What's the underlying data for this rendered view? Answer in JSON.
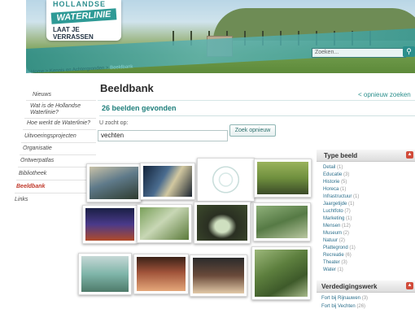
{
  "logo": {
    "line1": "HOLLANDSE",
    "line2": "WATERLINIE",
    "tagline": "LAAT JE VERRASSEN"
  },
  "search": {
    "placeholder": "Zoeken...",
    "button_icon": "search-icon"
  },
  "breadcrumb": {
    "home": "Home",
    "sep1": ">",
    "section": "Kennis en Achtergronden",
    "sep2": ">",
    "current": "Beeldbank"
  },
  "sidebar": {
    "items": [
      {
        "label": "Nieuws"
      },
      {
        "label": "Wat is de Hollandse Waterlinie?"
      },
      {
        "label": "Hoe werkt de Waterlinie?"
      },
      {
        "label": "Uitvoeringsprojecten"
      },
      {
        "label": "Organisatie"
      },
      {
        "label": "Ontwerpatlas"
      },
      {
        "label": "Bibliotheek"
      },
      {
        "label": "Beeldbank"
      },
      {
        "label": "Links"
      }
    ]
  },
  "main": {
    "title": "Beeldbank",
    "back_link": "< opnieuw zoeken",
    "result_count": "26 beelden gevonden",
    "search_label": "U zocht op:",
    "query": "vechten",
    "search_again": "Zoek opnieuw"
  },
  "filters": {
    "title": "Type beeld",
    "items": [
      {
        "label": "Detail",
        "count": "(1)"
      },
      {
        "label": "Educatie",
        "count": "(3)"
      },
      {
        "label": "Historie",
        "count": "(5)"
      },
      {
        "label": "Horeca",
        "count": "(1)"
      },
      {
        "label": "Infrastructuur",
        "count": "(1)"
      },
      {
        "label": "Jaargetijde",
        "count": "(1)"
      },
      {
        "label": "Luchtfoto",
        "count": "(7)"
      },
      {
        "label": "Marketing",
        "count": "(1)"
      },
      {
        "label": "Mensen",
        "count": "(12)"
      },
      {
        "label": "Museum",
        "count": "(2)"
      },
      {
        "label": "Natuur",
        "count": "(2)"
      },
      {
        "label": "Plattegrond",
        "count": "(1)"
      },
      {
        "label": "Recreatie",
        "count": "(6)"
      },
      {
        "label": "Theater",
        "count": "(3)"
      },
      {
        "label": "Water",
        "count": "(1)"
      }
    ]
  },
  "defense": {
    "title": "Verdedigingswerk",
    "items": [
      {
        "label": "Fort bij Rijnauwen",
        "count": "(3)"
      },
      {
        "label": "Fort bij Vechten",
        "count": "(26)"
      }
    ]
  },
  "colors": {
    "accent": "#2b8f8c",
    "active": "#c0392b",
    "link": "#2b6f8c"
  }
}
